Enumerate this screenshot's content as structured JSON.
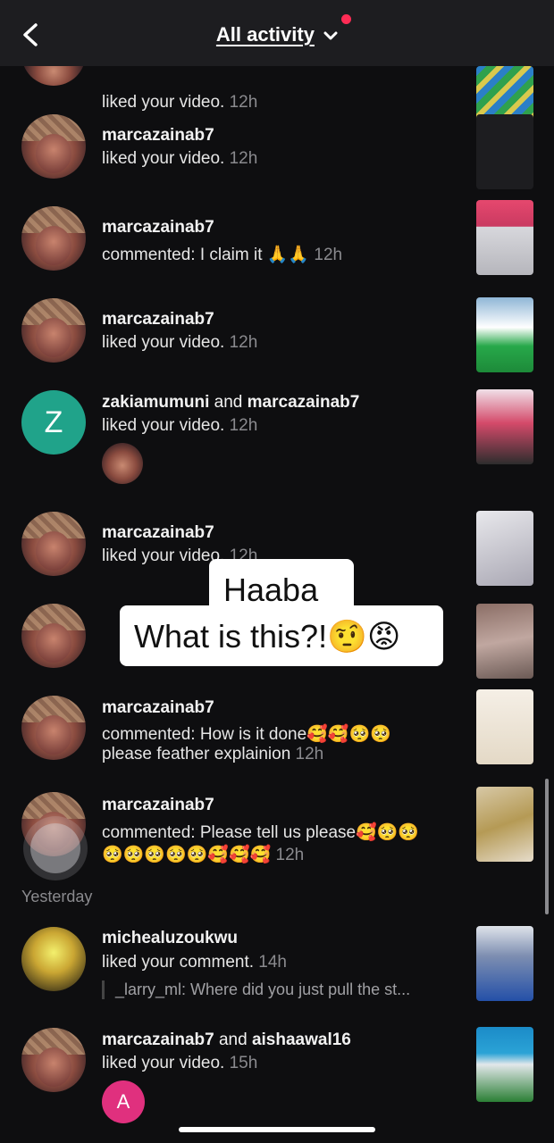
{
  "header": {
    "title": "All activity",
    "back_icon": "chevron-left-icon",
    "dropdown_icon": "chevron-down-icon",
    "notification_dot_color": "#ff2c55"
  },
  "notifications": [
    {
      "user": "marcazainab7",
      "action": "liked your video.",
      "time": "12h"
    },
    {
      "user": "marcazainab7",
      "action": "commented: I claim it 🙏🙏",
      "time": "12h"
    },
    {
      "user": "marcazainab7",
      "action": "liked your video.",
      "time": "12h"
    },
    {
      "user": "zakiamumuni",
      "and": "and",
      "user2": "marcazainab7",
      "action": "liked your video.",
      "time": "12h",
      "avatar_letter": "Z"
    },
    {
      "user": "marcazainab7",
      "action": "liked your video.",
      "time": "12h"
    },
    {
      "user": "marcazainab7",
      "action": "commented: How is it done🥰🥰🥺🥺",
      "action_line2": "please feather explainion",
      "time": "12h"
    },
    {
      "user": "marcazainab7",
      "action": "commented: Please tell us please🥰🥺🥺",
      "action_line2": "🥺🥺🥺🥺🥺🥰🥰🥰",
      "time": "12h"
    }
  ],
  "top_partial": {
    "action": "liked your video.",
    "time": "12h"
  },
  "section_yesterday": "Yesterday",
  "yesterday": [
    {
      "user": "michealuzoukwu",
      "action": "liked your comment.",
      "time": "14h",
      "quote": "_larry_ml: Where did you just pull the st..."
    },
    {
      "user": "marcazainab7",
      "and": "and",
      "user2": "aishaawal16",
      "action": "liked your video.",
      "time": "15h",
      "avatar_letter": "A"
    }
  ],
  "overlay": {
    "line1": "Haaba",
    "line2": "What is this?!🤨😡"
  }
}
